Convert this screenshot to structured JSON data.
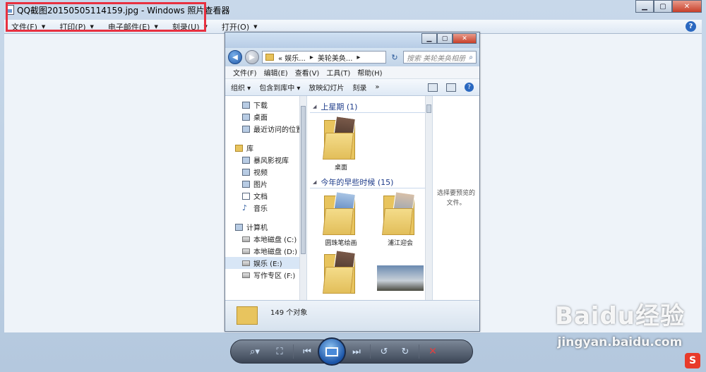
{
  "viewer": {
    "title": "QQ截图20150505114159.jpg - Windows 照片查看器",
    "menu": [
      {
        "label": "文件(F)"
      },
      {
        "label": "打印(P)"
      },
      {
        "label": "电子邮件(E)"
      },
      {
        "label": "刻录(U)"
      },
      {
        "label": "打开(O)"
      }
    ],
    "help": "?"
  },
  "explorer": {
    "address": {
      "part1": "« 娱乐...",
      "part2": "美轮美奂...",
      "sep": "▸"
    },
    "search_placeholder": "搜索 美轮美奂相册",
    "menu": [
      "文件(F)",
      "编辑(E)",
      "查看(V)",
      "工具(T)",
      "帮助(H)"
    ],
    "toolbar": {
      "organize": "组织 ▾",
      "include": "包含到库中 ▾",
      "slideshow": "放映幻灯片",
      "burn": "刻录",
      "more": "»"
    },
    "nav": {
      "favorites": [
        {
          "label": "下载"
        },
        {
          "label": "桌面"
        },
        {
          "label": "最近访问的位置"
        }
      ],
      "libraries_label": "库",
      "libraries": [
        {
          "label": "暴风影视库"
        },
        {
          "label": "视频"
        },
        {
          "label": "图片"
        },
        {
          "label": "文档"
        },
        {
          "label": "音乐"
        }
      ],
      "computer_label": "计算机",
      "drives": [
        {
          "label": "本地磁盘 (C:)"
        },
        {
          "label": "本地磁盘 (D:)"
        },
        {
          "label": "娱乐 (E:)"
        },
        {
          "label": "写作专区 (F:)"
        }
      ]
    },
    "groups": [
      {
        "title": "上星期 (1)",
        "items": [
          {
            "label": "桌面"
          }
        ]
      },
      {
        "title": "今年的早些时候 (15)",
        "items": [
          {
            "label": "圆珠笔绘画"
          },
          {
            "label": "浦江迎会"
          }
        ]
      }
    ],
    "preview_text": "选择要预览的文件。",
    "status": "149 个对象"
  },
  "watermark": {
    "brand": "Baidu经验",
    "url": "jingyan.baidu.com"
  },
  "colors": {
    "highlight": "#e83040",
    "accent": "#2a68c0"
  }
}
